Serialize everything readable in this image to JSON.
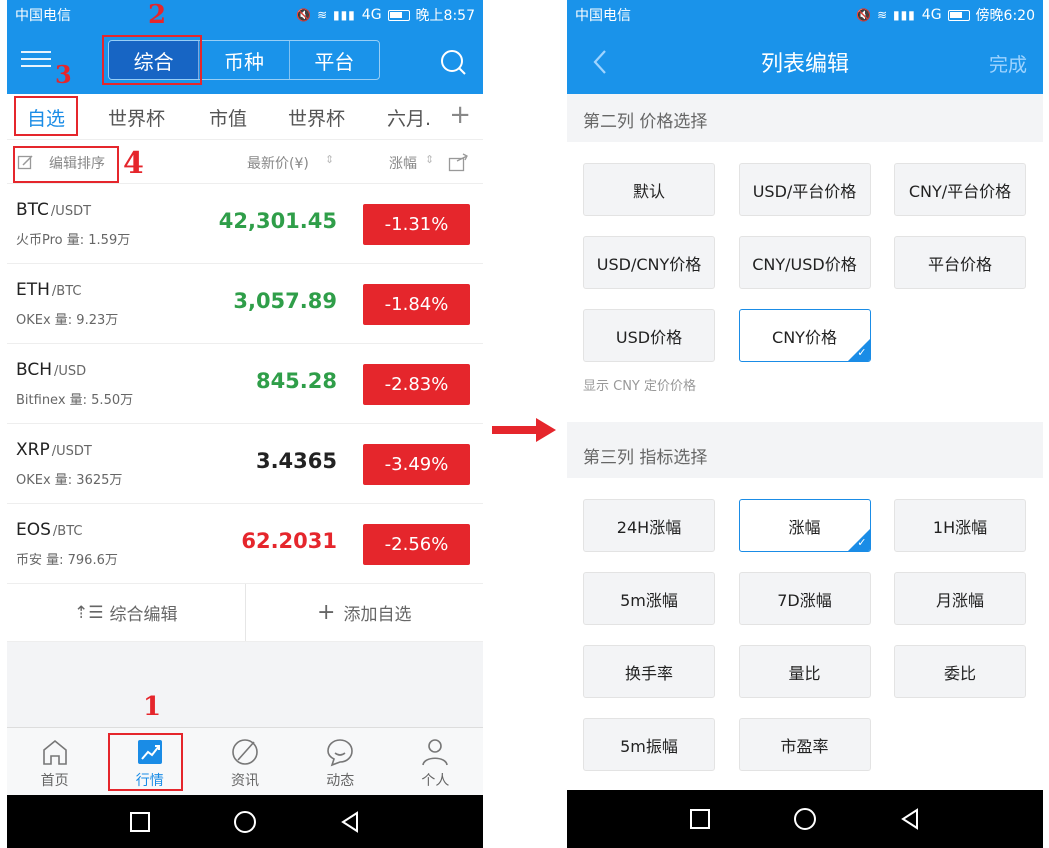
{
  "left": {
    "status": {
      "carrier": "中国电信",
      "net": "4G",
      "time": "晚上8:57"
    },
    "header": {
      "segments": [
        "综合",
        "币种",
        "平台"
      ],
      "active_segment": 0
    },
    "tabs": [
      "自选",
      "世界杯",
      "市值",
      "世界杯",
      "六月."
    ],
    "columns": {
      "edit_sort": "编辑排序",
      "latest_price": "最新价(¥)",
      "change": "涨幅"
    },
    "rows": [
      {
        "symbol": "BTC",
        "quote": "/USDT",
        "exchange": "火币Pro 量: 1.59万",
        "price": "42,301.45",
        "change": "-1.31%",
        "color": "#2f9e49"
      },
      {
        "symbol": "ETH",
        "quote": "/BTC",
        "exchange": "OKEx 量: 9.23万",
        "price": "3,057.89",
        "change": "-1.84%",
        "color": "#2f9e49"
      },
      {
        "symbol": "BCH",
        "quote": "/USD",
        "exchange": "Bitfinex 量: 5.50万",
        "price": "845.28",
        "change": "-2.83%",
        "color": "#2f9e49"
      },
      {
        "symbol": "XRP",
        "quote": "/USDT",
        "exchange": "OKEx 量: 3625万",
        "price": "3.4365",
        "change": "-3.49%",
        "color": "#222222"
      },
      {
        "symbol": "EOS",
        "quote": "/BTC",
        "exchange": "币安 量: 796.6万",
        "price": "62.2031",
        "change": "-2.56%",
        "color": "#e5262c"
      }
    ],
    "actions": {
      "edit_all": "综合编辑",
      "add_fav": "添加自选"
    },
    "nav": [
      {
        "label": "首页",
        "icon": "home-icon"
      },
      {
        "label": "行情",
        "icon": "market-chart-icon"
      },
      {
        "label": "资讯",
        "icon": "news-icon"
      },
      {
        "label": "动态",
        "icon": "chat-icon"
      },
      {
        "label": "个人",
        "icon": "person-icon"
      }
    ],
    "nav_active": 1,
    "annotations": {
      "n1": "1",
      "n2": "2",
      "n3": "3",
      "n4": "4"
    }
  },
  "right": {
    "status": {
      "carrier": "中国电信",
      "net": "4G",
      "time": "傍晚6:20"
    },
    "header": {
      "title": "列表编辑",
      "done": "完成"
    },
    "section2": {
      "title": "第二列  价格选择",
      "options": [
        "默认",
        "USD/平台价格",
        "CNY/平台价格",
        "USD/CNY价格",
        "CNY/USD价格",
        "平台价格",
        "USD价格",
        "CNY价格"
      ],
      "selected": 7,
      "hint": "显示 CNY 定价价格"
    },
    "section3": {
      "title": "第三列  指标选择",
      "options": [
        "24H涨幅",
        "涨幅",
        "1H涨幅",
        "5m涨幅",
        "7D涨幅",
        "月涨幅",
        "换手率",
        "量比",
        "委比",
        "5m振幅",
        "市盈率"
      ],
      "selected": 1
    }
  },
  "colors": {
    "primary": "#1a93ea",
    "accent": "#1a8ce6",
    "down": "#e5262c",
    "annotation": "#e5262c"
  }
}
